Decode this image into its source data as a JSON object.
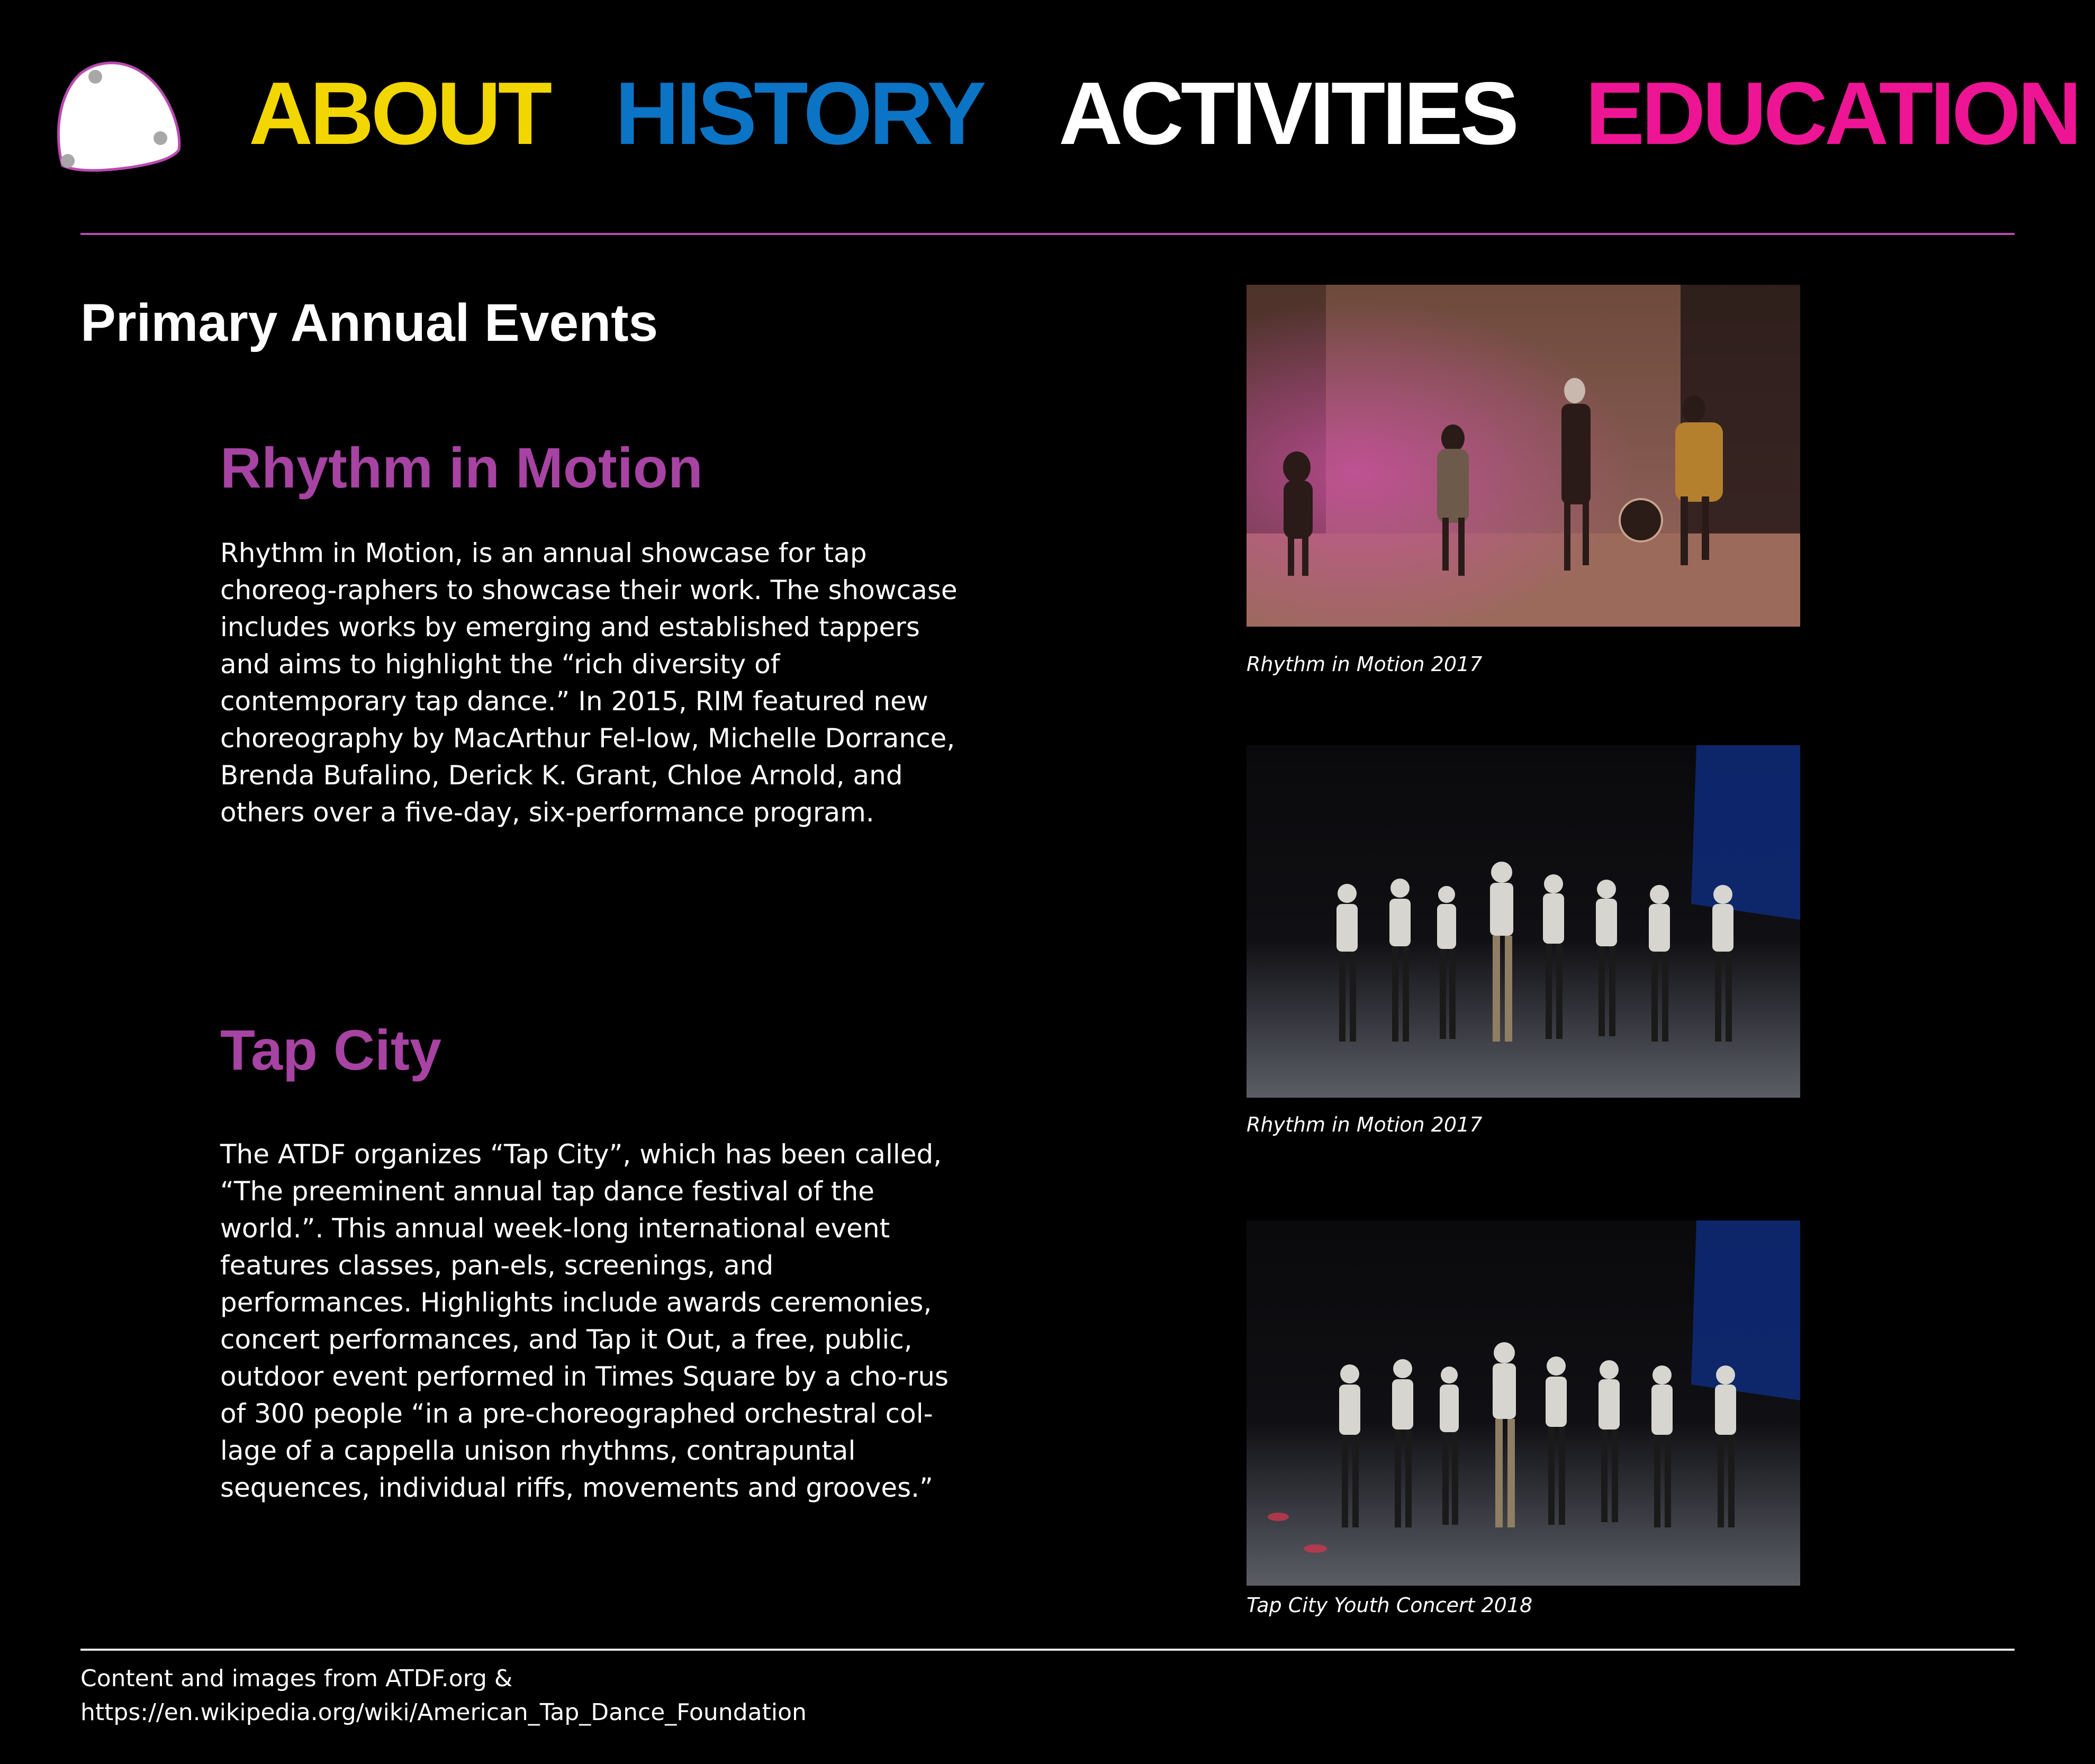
{
  "nav": {
    "items": [
      {
        "label": "ABOUT",
        "color": "#f2d600"
      },
      {
        "label": "HISTORY",
        "color": "#0b74c4"
      },
      {
        "label": "ACTIVITIES",
        "color": "#ffffff"
      },
      {
        "label": "EDUCATION",
        "color": "#ee1595"
      }
    ]
  },
  "colors": {
    "accent_rule": "#b84ab0",
    "event_title": "#a743a2",
    "background": "#000000"
  },
  "page_title": "Primary Annual Events",
  "events": [
    {
      "title": "Rhythm in Motion",
      "body": "Rhythm in Motion, is an annual showcase for tap choreog-raphers to showcase their work. The showcase includes works by emerging and established tappers and aims to highlight the “rich diversity of contemporary tap dance.” In 2015, RIM featured new choreography by MacArthur Fel-low, Michelle Dorrance, Brenda Bufalino, Derick K. Grant, Chloe Arnold, and others over a five-day, six-performance program."
    },
    {
      "title": "Tap City",
      "body": "The ATDF organizes “Tap City”, which has been called, “The preeminent annual tap dance festival of the world.”. This annual week-long international event features classes, pan-els, screenings, and performances. Highlights include awards ceremonies, concert performances, and Tap it Out, a free, public, outdoor event performed in Times Square by a cho-rus of 300 people “in a pre-choreographed orchestral col-lage of a cappella unison rhythms, contrapuntal sequences, individual riffs, movements and grooves.”"
    }
  ],
  "photos": [
    {
      "caption": "Rhythm in Motion 2017",
      "scene": "stage-warm"
    },
    {
      "caption": "Rhythm in Motion 2017",
      "scene": "stage-dark"
    },
    {
      "caption": "Tap City Youth Concert 2018",
      "scene": "stage-dark"
    }
  ],
  "footer": {
    "line1": "Content and images from ATDF.org &",
    "line2": "https://en.wikipedia.org/wiki/American_Tap_Dance_Foundation"
  }
}
